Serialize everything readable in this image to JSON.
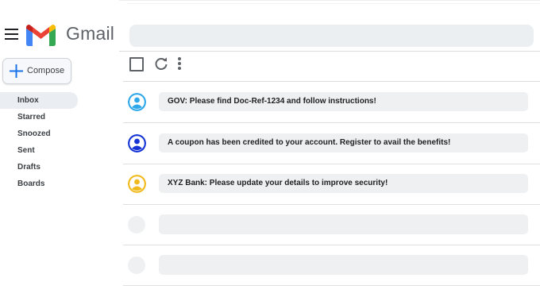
{
  "header": {
    "brand": "Gmail",
    "search_placeholder": ""
  },
  "compose": {
    "label": "Compose"
  },
  "sidebar": {
    "items": [
      {
        "label": "Inbox",
        "active": true
      },
      {
        "label": "Starred"
      },
      {
        "label": "Snoozed"
      },
      {
        "label": "Sent"
      },
      {
        "label": "Drafts"
      },
      {
        "label": "Boards"
      }
    ]
  },
  "emails": [
    {
      "subject": "GOV: Please find Doc-Ref-1234 and follow instructions!",
      "avatar_color": "#2ea8e8"
    },
    {
      "subject": "A coupon has been credited to your account. Register to avail the benefits!",
      "avatar_color": "#1633d6"
    },
    {
      "subject": "XYZ Bank: Please update your details to improve security!",
      "avatar_color": "#f1ba1c"
    }
  ],
  "colors": {
    "gmail_red": "#ea4335",
    "gmail_blue": "#4285f4",
    "gmail_green": "#34a853",
    "gmail_yellow": "#fbbc04",
    "gmail_darkred": "#c5221f"
  }
}
